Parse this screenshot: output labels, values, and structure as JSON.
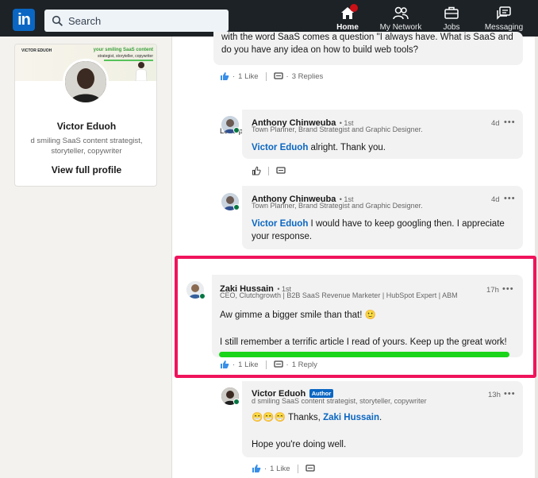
{
  "nav": {
    "search_placeholder": "Search",
    "items": [
      {
        "label": "Home"
      },
      {
        "label": "My Network"
      },
      {
        "label": "Jobs"
      },
      {
        "label": "Messaging"
      }
    ]
  },
  "profile": {
    "cover_brand": "VICTOR EDUOH",
    "cover_tag1": "your smiling SaaS content",
    "cover_tag2": "strategist, storyteller, copywriter",
    "name": "Victor Eduoh",
    "headline": "d smiling SaaS content strategist, storyteller, copywriter",
    "view_profile": "View full profile"
  },
  "top_comment": {
    "text_line1": "with the word SaaS comes a question \"I always have. What is SaaS and",
    "text_line2": "do you have any idea on how to build web tools?",
    "likes": "1 Like",
    "replies": "3 Replies"
  },
  "load_previous": "Load previous replies",
  "replies": [
    {
      "name": "Anthony Chinweuba",
      "degree": "• 1st",
      "headline": "Town Planner, Brand Strategist and Graphic Designer.",
      "time": "4d",
      "mention": "Victor Eduoh",
      "text": " alright. Thank you."
    },
    {
      "name": "Anthony Chinweuba",
      "degree": "• 1st",
      "headline": "Town Planner, Brand Strategist and Graphic Designer.",
      "time": "4d",
      "mention": "Victor Eduoh",
      "text_line1": " I would have to keep googling then. I appreciate",
      "text_line2": "your response."
    }
  ],
  "zaki": {
    "name": "Zaki Hussain",
    "degree": "• 1st",
    "headline": "CEO, Clutchgrowth | B2B SaaS Revenue Marketer | HubSpot Expert | ABM",
    "time": "17h",
    "text1": "Aw gimme a bigger smile than that! 🙂",
    "text2": "I still remember a terrific article I read of yours. Keep up the great work!",
    "likes": "1 Like",
    "replies": "1 Reply"
  },
  "victor_reply": {
    "name": "Victor Eduoh",
    "badge": "Author",
    "headline": "d smiling SaaS content strategist, storyteller, copywriter",
    "time": "13h",
    "emoji": "😁😁😁",
    "text_pre": " Thanks, ",
    "mention": "Zaki Hussain",
    "text_post": ".",
    "text2": "Hope you're doing well.",
    "likes": "1 Like"
  },
  "colors": {
    "linkedin_blue": "#0a66c2",
    "nav_bg": "#1d2226",
    "highlight_border": "#f0135c",
    "underline_green": "#19d419"
  }
}
